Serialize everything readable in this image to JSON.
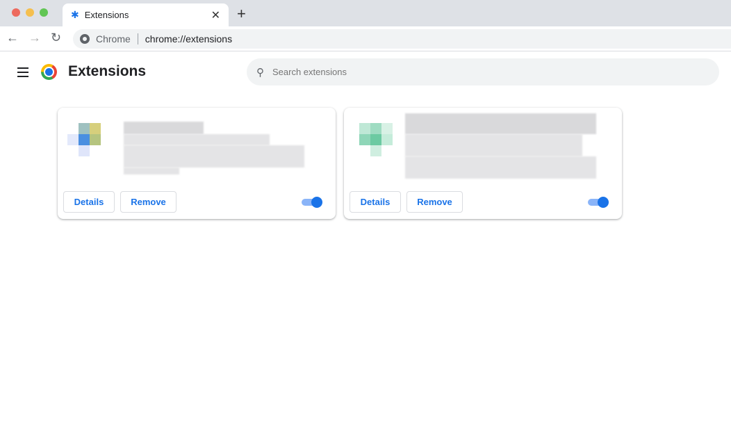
{
  "tab": {
    "title": "Extensions",
    "close": "✕",
    "new_tab": "+"
  },
  "omnibox": {
    "origin": "Chrome",
    "url": "chrome://extensions"
  },
  "header": {
    "title": "Extensions",
    "search_placeholder": "Search extensions"
  },
  "cards": [
    {
      "details": "Details",
      "remove": "Remove",
      "enabled": true
    },
    {
      "details": "Details",
      "remove": "Remove",
      "enabled": true
    }
  ]
}
